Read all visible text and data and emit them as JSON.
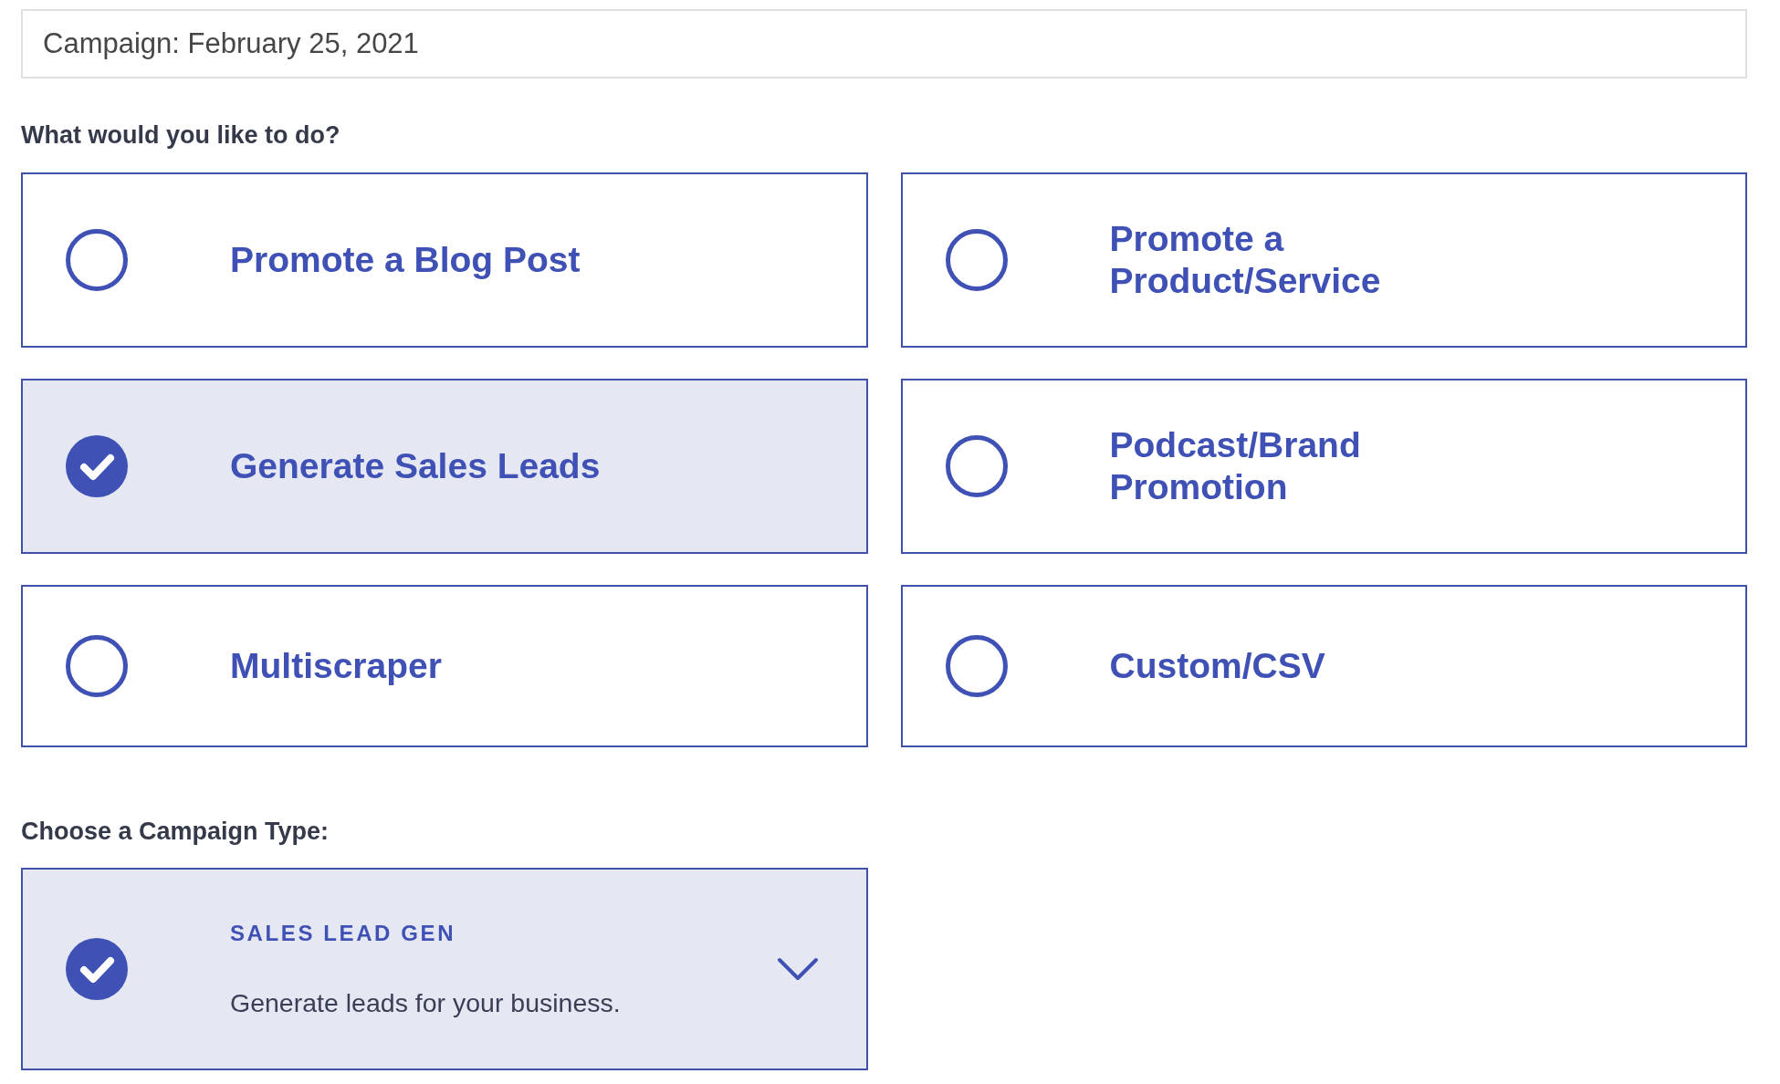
{
  "campaign_name": {
    "value": "Campaign: February 25, 2021"
  },
  "goal_question": "What would you like to do?",
  "goals": [
    {
      "label": "Promote a Blog Post",
      "selected": false
    },
    {
      "label": "Promote a Product/Service",
      "selected": false
    },
    {
      "label": "Generate Sales Leads",
      "selected": true
    },
    {
      "label": "Podcast/Brand Promotion",
      "selected": false
    },
    {
      "label": "Multiscraper",
      "selected": false
    },
    {
      "label": "Custom/CSV",
      "selected": false
    }
  ],
  "campaign_type_heading": "Choose a Campaign Type:",
  "campaign_type": {
    "title": "SALES LEAD GEN",
    "description": "Generate leads for your business.",
    "selected": true,
    "expanded": false
  }
}
